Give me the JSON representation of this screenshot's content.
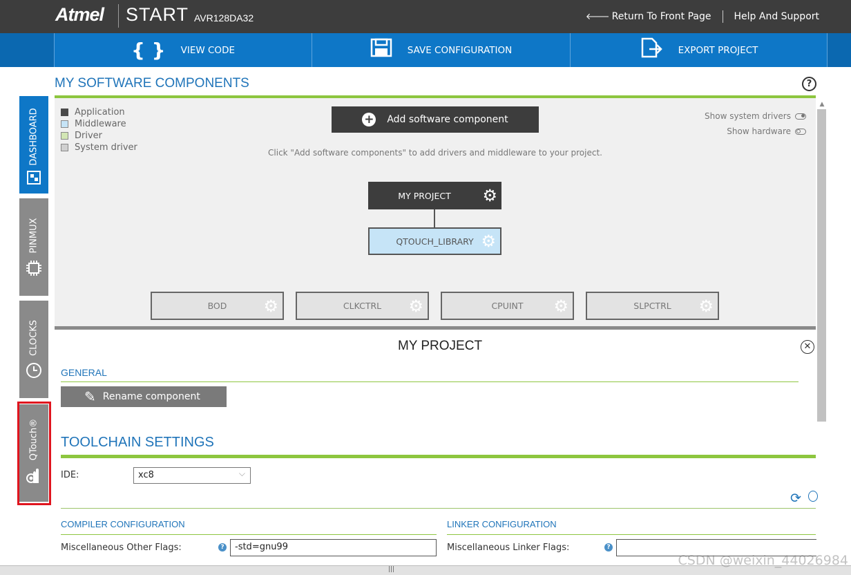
{
  "header": {
    "logo": "Atmel",
    "product": "START",
    "device": "AVR128DA32",
    "return_link": "Return To Front Page",
    "help_link": "Help And Support"
  },
  "toolbar": {
    "view_code": "VIEW CODE",
    "save_configuration": "SAVE CONFIGURATION",
    "export_project": "EXPORT PROJECT"
  },
  "sidebar": {
    "tabs": [
      {
        "label": "DASHBOARD",
        "icon": "dashboard-icon",
        "active": true
      },
      {
        "label": "PINMUX",
        "icon": "chip-icon",
        "active": false
      },
      {
        "label": "CLOCKS",
        "icon": "clock-icon",
        "active": false
      },
      {
        "label": "QTouch®",
        "icon": "touch-icon",
        "active": false,
        "highlighted": true
      }
    ]
  },
  "main": {
    "title": "MY SOFTWARE COMPONENTS",
    "legend": [
      {
        "label": "Application",
        "color": "#4a4a4a"
      },
      {
        "label": "Middleware",
        "color": "#c6e4f7"
      },
      {
        "label": "Driver",
        "color": "#d2e6b4"
      },
      {
        "label": "System driver",
        "color": "#d0d0d0"
      }
    ],
    "add_button": "Add software component",
    "hint": "Click \"Add software components\" to add drivers and middleware to your project.",
    "toggles": {
      "show_system_drivers": "Show system drivers",
      "show_hardware": "Show hardware"
    },
    "nodes": {
      "project": "MY PROJECT",
      "qtouch": "QTOUCH_LIBRARY",
      "system": [
        "BOD",
        "CLKCTRL",
        "CPUINT",
        "SLPCTRL"
      ]
    }
  },
  "properties": {
    "title": "MY PROJECT",
    "general_heading": "GENERAL",
    "rename_button": "Rename component",
    "toolchain_heading": "TOOLCHAIN SETTINGS",
    "ide_label": "IDE:",
    "ide_value": "xc8",
    "compiler_heading": "COMPILER CONFIGURATION",
    "linker_heading": "LINKER CONFIGURATION",
    "misc_other_flags_label": "Miscellaneous Other Flags:",
    "misc_other_flags_value": "-std=gnu99",
    "misc_linker_flags_label": "Miscellaneous Linker Flags:",
    "misc_linker_flags_value": ""
  },
  "watermark": "CSDN @weixin_44026984",
  "colors": {
    "header_bg": "#3d3d3d",
    "toolbar_blue": "#0e77c7",
    "accent_green": "#8dc63f",
    "heading_blue": "#1f74b9",
    "highlight_red": "#e0141e"
  }
}
